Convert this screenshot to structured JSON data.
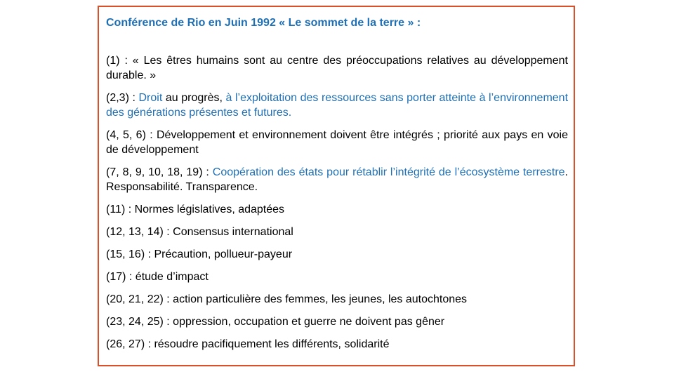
{
  "title": "Conférence de Rio en Juin 1992 « Le sommet de la terre » :",
  "accent_color": "#1f6fb5",
  "border_color": "#d9502a",
  "items": [
    {
      "segments": [
        {
          "text": "(1) : « Les êtres humains sont au centre des préoccupations relatives au développement durable. »",
          "highlight": false
        }
      ]
    },
    {
      "segments": [
        {
          "text": "(2,3) : ",
          "highlight": false
        },
        {
          "text": "Droit",
          "highlight": true
        },
        {
          "text": " au progrès, ",
          "highlight": false
        },
        {
          "text": "à l’exploitation des ressources sans porter atteinte à l’environnement des générations présentes et futures.",
          "highlight": true
        }
      ]
    },
    {
      "segments": [
        {
          "text": "(4, 5, 6) : Développement et environnement doivent être intégrés ; priorité aux pays en voie de développement",
          "highlight": false
        }
      ]
    },
    {
      "segments": [
        {
          "text": "(7, 8, 9, 10, 18, 19) : ",
          "highlight": false
        },
        {
          "text": "Coopération des états pour rétablir l’intégrité de l’écosystème terrestre",
          "highlight": true
        },
        {
          "text": ". Responsabilité. Transparence.",
          "highlight": false
        }
      ]
    },
    {
      "segments": [
        {
          "text": "(11) : Normes législatives, adaptées",
          "highlight": false
        }
      ]
    },
    {
      "segments": [
        {
          "text": "(12, 13, 14) : Consensus international",
          "highlight": false
        }
      ]
    },
    {
      "segments": [
        {
          "text": "(15, 16) : Précaution, pollueur-payeur",
          "highlight": false
        }
      ]
    },
    {
      "segments": [
        {
          "text": "(17) : étude d’impact",
          "highlight": false
        }
      ]
    },
    {
      "segments": [
        {
          "text": "(20, 21, 22) : action particulière des femmes, les jeunes, les autochtones",
          "highlight": false
        }
      ]
    },
    {
      "segments": [
        {
          "text": "(23, 24, 25) : oppression, occupation et guerre ne doivent pas gêner",
          "highlight": false
        }
      ]
    },
    {
      "segments": [
        {
          "text": "(26, 27) : résoudre pacifiquement les différents, solidarité",
          "highlight": false
        }
      ]
    }
  ]
}
